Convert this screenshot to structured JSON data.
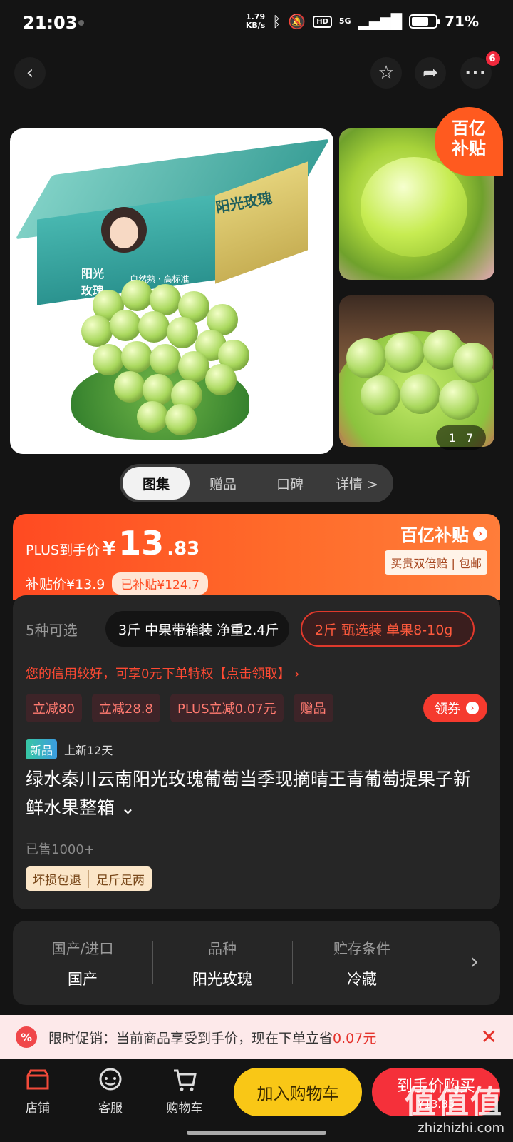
{
  "status_bar": {
    "time": "21:03",
    "net_speed": "1.79",
    "net_unit": "KB/s",
    "hd": "HD",
    "network": "5G",
    "battery_pct": "71%",
    "battery_level": 0.71
  },
  "nav": {
    "back_icon": "chevron-left-icon",
    "favorite_icon": "star-icon",
    "share_icon": "share-icon",
    "more_icon": "more-dots-icon",
    "more_badge": "6"
  },
  "gallery": {
    "box_brand": "阳光玫瑰",
    "box_side_text": "阳光 玫瑰",
    "box_tag": "自然熟 · 高标准",
    "subsidy_corner": "百亿\n补贴",
    "counter_current": "1",
    "counter_total": "7",
    "tabs": [
      "图集",
      "赠品",
      "口碑",
      "详情 >"
    ],
    "active_tab": 0
  },
  "price": {
    "plus_label": "PLUS到手价",
    "currency": "¥",
    "int_part": "13",
    "dec_part": ".83",
    "subsidy_price": "补贴价¥13.9",
    "subsidy_amount": "已补贴¥124.7",
    "brand_title": "百亿补贴",
    "brand_desc": "买贵双倍赔 | 包邮"
  },
  "info": {
    "sku_count": "5种可选",
    "sku_options": [
      "3斤 中果带箱装 净重2.4斤",
      "2斤 甄选装 单果8-10g"
    ],
    "credit_text": "您的信用较好，可享0元下单特权【点击领取】 ›",
    "promos": [
      "立减80",
      "立减28.8",
      "PLUS立减0.07元",
      "赠品"
    ],
    "coupon_label": "领券",
    "new_badge": "新品",
    "new_days": "上新12天",
    "title": "绿水秦川云南阳光玫瑰葡萄当季现摘晴王青葡萄提果子新鲜水果整箱 ⌄",
    "sold": "已售1000+",
    "service_tags": [
      "坏损包退",
      "足斤足两"
    ]
  },
  "attributes": [
    {
      "key": "国产/进口",
      "value": "国产"
    },
    {
      "key": "品种",
      "value": "阳光玫瑰"
    },
    {
      "key": "贮存条件",
      "value": "冷藏"
    }
  ],
  "banner": {
    "icon": "%",
    "text_prefix": "限时促销：当前商品享受到手价，现在下单立省",
    "text_highlight": "0.07元",
    "close_icon": "close-icon"
  },
  "bottom_bar": {
    "shop_label": "店铺",
    "service_label": "客服",
    "cart_label": "购物车",
    "add_cart_label": "加入购物车",
    "buy_label": "到手价购买",
    "buy_sub": "¥13.83"
  },
  "watermark": {
    "brand": "值值值",
    "url": "zhizhizhi.com"
  }
}
